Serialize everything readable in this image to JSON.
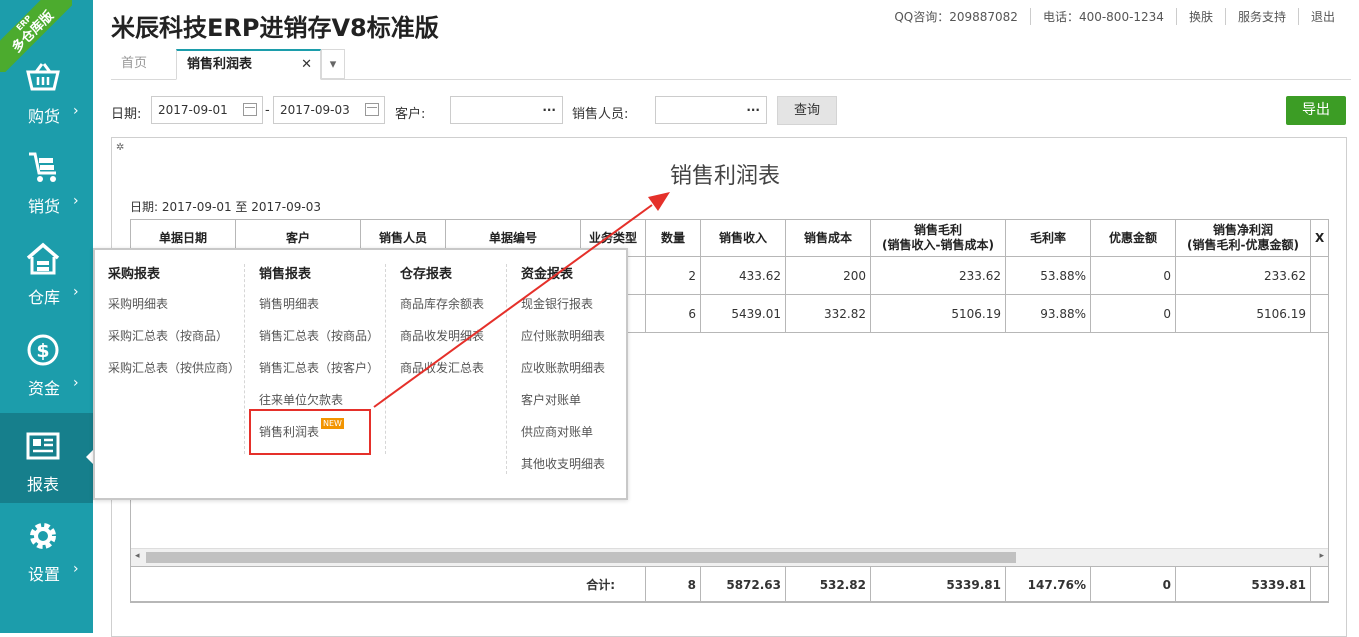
{
  "app": {
    "title": "米辰科技ERP进销存V8标准版",
    "ribbon_top": "ERP",
    "ribbon_label": "多仓库版"
  },
  "top_links": [
    "QQ咨询：209887082",
    "电话：400-800-1234",
    "换肤",
    "服务支持",
    "退出"
  ],
  "sidebar": {
    "items": [
      {
        "label": "购货",
        "icon": "basket-icon"
      },
      {
        "label": "销货",
        "icon": "cart-icon"
      },
      {
        "label": "仓库",
        "icon": "house-icon"
      },
      {
        "label": "资金",
        "icon": "dollar-icon"
      },
      {
        "label": "报表",
        "icon": "report-icon",
        "active": true
      },
      {
        "label": "设置",
        "icon": "gear-icon"
      }
    ],
    "chevron": "›"
  },
  "tabs": {
    "home": "首页",
    "active": "销售利润表",
    "close": "✕",
    "more": "▾"
  },
  "filters": {
    "date_label": "日期:",
    "date_from": "2017-09-01",
    "date_sep": "-",
    "date_to": "2017-09-03",
    "customer_label": "客户:",
    "customer_value": "",
    "sales_label": "销售人员:",
    "sales_value": "",
    "dots": "···",
    "query": "查询",
    "export": "导出"
  },
  "report": {
    "title": "销售利润表",
    "date_range": "日期: 2017-09-01 至 2017-09-03",
    "columns": [
      "单据日期",
      "客户",
      "销售人员",
      "单据编号",
      "业务类型",
      "数量",
      "销售收入",
      "销售成本",
      "销售毛利\n(销售收入-销售成本)",
      "毛利率",
      "优惠金额",
      "销售净利润\n(销售毛利-优惠金额)",
      "X"
    ],
    "rows": [
      [
        "",
        "",
        "",
        "",
        "",
        "2",
        "433.62",
        "200",
        "233.62",
        "53.88%",
        "0",
        "233.62",
        ""
      ],
      [
        "",
        "",
        "",
        "",
        "",
        "6",
        "5439.01",
        "332.82",
        "5106.19",
        "93.88%",
        "0",
        "5106.19",
        ""
      ]
    ],
    "totals": {
      "label": "合计:",
      "qty": "8",
      "income": "5872.63",
      "cost": "532.82",
      "gross": "5339.81",
      "rate": "147.76%",
      "discount": "0",
      "net": "5339.81"
    }
  },
  "menu": {
    "columns": [
      {
        "title": "采购报表",
        "items": [
          "采购明细表",
          "采购汇总表（按商品）",
          "采购汇总表（按供应商）"
        ]
      },
      {
        "title": "销售报表",
        "items": [
          "销售明细表",
          "销售汇总表（按商品）",
          "销售汇总表（按客户）",
          "往来单位欠款表",
          "销售利润表"
        ]
      },
      {
        "title": "仓存报表",
        "items": [
          "商品库存余额表",
          "商品收发明细表",
          "商品收发汇总表"
        ]
      },
      {
        "title": "资金报表",
        "items": [
          "现金银行报表",
          "应付账款明细表",
          "应收账款明细表",
          "客户对账单",
          "供应商对账单",
          "其他收支明细表"
        ]
      }
    ],
    "new_badge": "NEW"
  },
  "colors": {
    "sidebar": "#1c9dab",
    "sidebar_active": "#167f8c",
    "export": "#3c9d25",
    "ribbon": "#4cab2e",
    "annotation": "#e5302a"
  }
}
